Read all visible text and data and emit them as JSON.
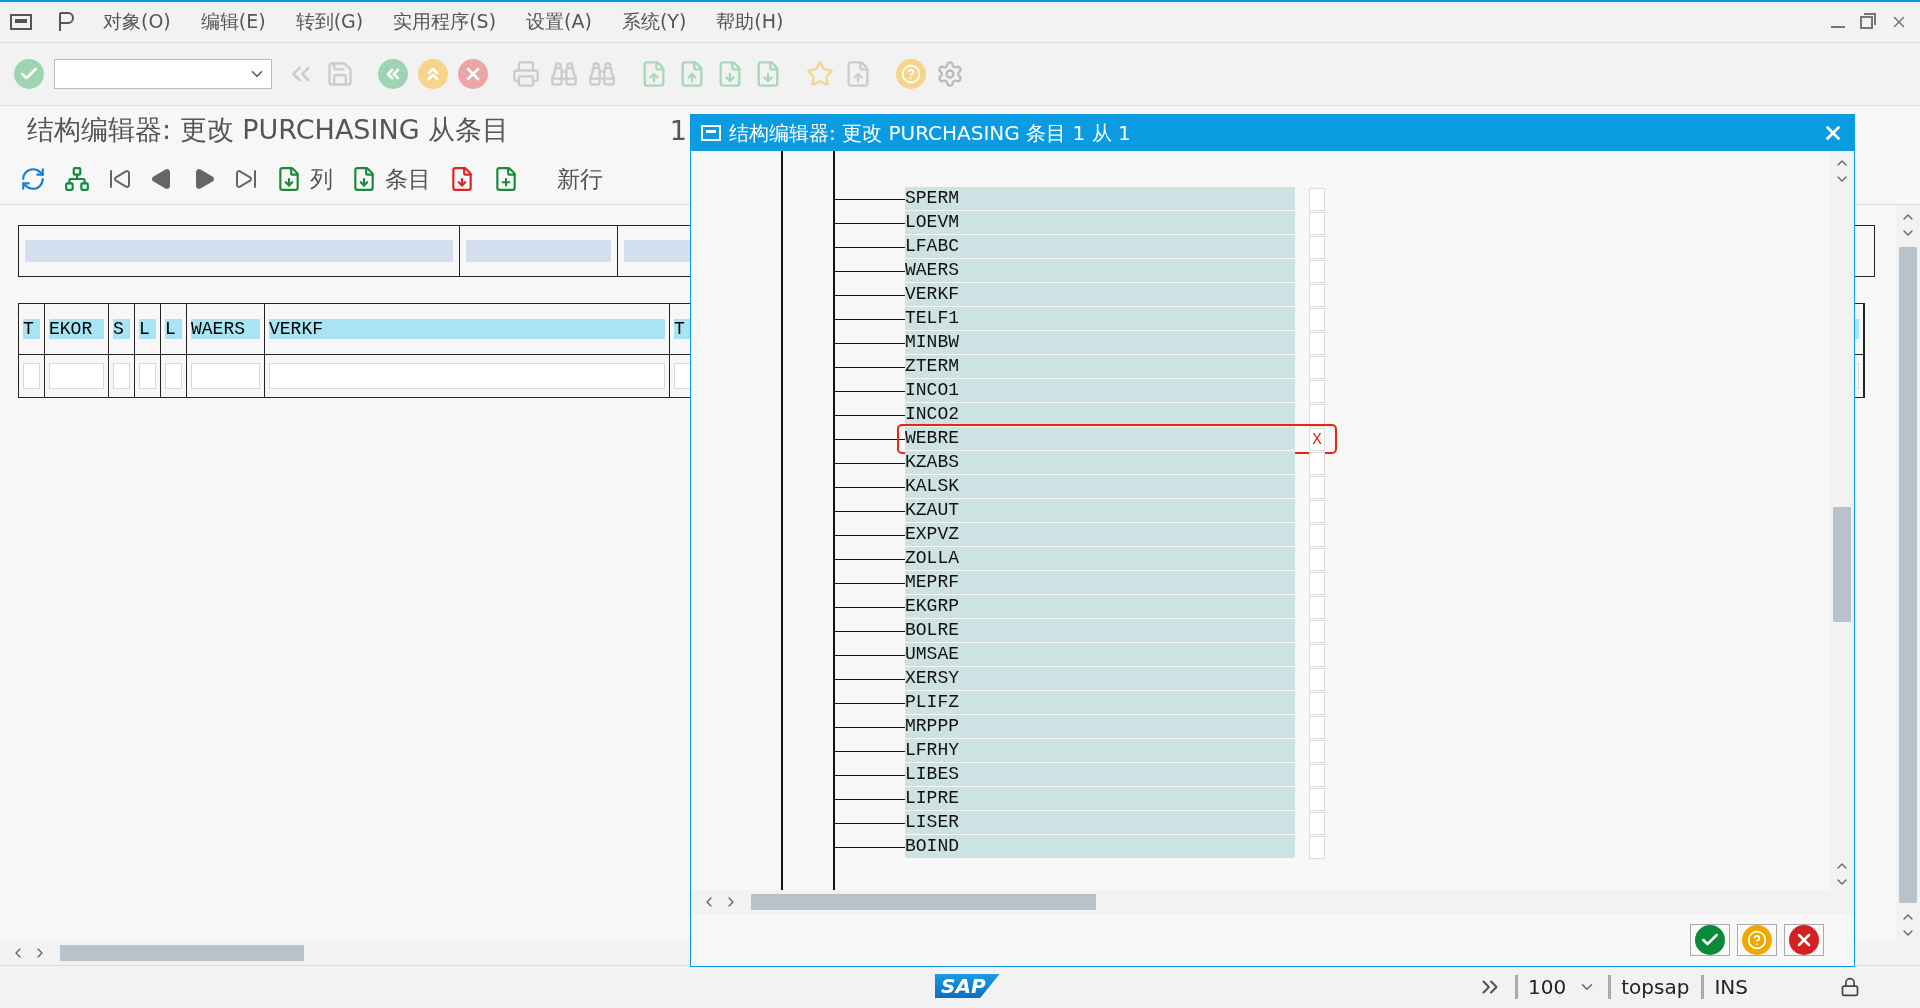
{
  "menu_bar": {
    "items": [
      "对象(O)",
      "编辑(E)",
      "转到(G)",
      "实用程序(S)",
      "设置(A)",
      "系统(Y)",
      "帮助(H)"
    ]
  },
  "screen": {
    "title": "结构编辑器: 更改 PURCHASING 从条目",
    "counter": "1"
  },
  "app_toolbar": {
    "buttons": [
      {
        "kind": "icon"
      },
      {
        "kind": "icon"
      },
      {
        "kind": "icon"
      },
      {
        "kind": "icon"
      },
      {
        "kind": "icon"
      },
      {
        "kind": "icon"
      },
      {
        "kind": "labeled",
        "label": "列"
      },
      {
        "kind": "labeled",
        "label": "条目"
      },
      {
        "kind": "icon"
      },
      {
        "kind": "icon"
      },
      {
        "kind": "text",
        "label": "新行"
      }
    ]
  },
  "table": {
    "columns": [
      "T",
      "EKOR",
      "S",
      "L",
      "L",
      "WAERS",
      "VERKF",
      "T"
    ]
  },
  "dialog": {
    "title": "结构编辑器: 更改 PURCHASING 条目 1 从 1",
    "items": [
      {
        "name": "SPERM",
        "highlighted": false
      },
      {
        "name": "LOEVM",
        "highlighted": false
      },
      {
        "name": "LFABC",
        "highlighted": false
      },
      {
        "name": "WAERS",
        "highlighted": false
      },
      {
        "name": "VERKF",
        "highlighted": false
      },
      {
        "name": "TELF1",
        "highlighted": false
      },
      {
        "name": "MINBW",
        "highlighted": false
      },
      {
        "name": "ZTERM",
        "highlighted": false
      },
      {
        "name": "INCO1",
        "highlighted": false
      },
      {
        "name": "INCO2",
        "highlighted": false
      },
      {
        "name": "WEBRE",
        "highlighted": true,
        "value": "X"
      },
      {
        "name": "KZABS",
        "highlighted": false
      },
      {
        "name": "KALSK",
        "highlighted": false
      },
      {
        "name": "KZAUT",
        "highlighted": false
      },
      {
        "name": "EXPVZ",
        "highlighted": false
      },
      {
        "name": "ZOLLA",
        "highlighted": false
      },
      {
        "name": "MEPRF",
        "highlighted": false
      },
      {
        "name": "EKGRP",
        "highlighted": false
      },
      {
        "name": "BOLRE",
        "highlighted": false
      },
      {
        "name": "UMSAE",
        "highlighted": false
      },
      {
        "name": "XERSY",
        "highlighted": false
      },
      {
        "name": "PLIFZ",
        "highlighted": false
      },
      {
        "name": "MRPPP",
        "highlighted": false
      },
      {
        "name": "LFRHY",
        "highlighted": false
      },
      {
        "name": "LIBES",
        "highlighted": false
      },
      {
        "name": "LIPRE",
        "highlighted": false
      },
      {
        "name": "LISER",
        "highlighted": false
      },
      {
        "name": "BOIND",
        "highlighted": false
      }
    ]
  },
  "status_bar": {
    "logo": "SAP",
    "zoom": "100",
    "user": "topsap",
    "mode": "INS"
  }
}
